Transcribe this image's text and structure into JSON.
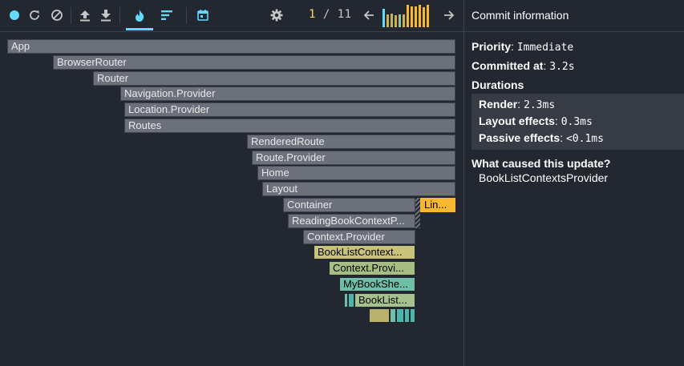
{
  "toolbar": {
    "icons": [
      "record-icon",
      "reload-icon",
      "clear-icon",
      "upload-icon",
      "download-icon",
      "flame-icon",
      "ranked-icon",
      "timeline-icon",
      "settings-icon",
      "arrow-left-icon",
      "arrow-right-icon"
    ],
    "accent": "#61dafb",
    "commit_current": "1",
    "commit_sep": "/",
    "commit_total": "11",
    "commit_bars": [
      {
        "level": 0.8,
        "color": "#61dafb"
      },
      {
        "level": 0.55,
        "color": "#d0b04e"
      },
      {
        "level": 0.6,
        "color": "#b8b86b"
      },
      {
        "level": 0.5,
        "color": "#d0b04e"
      },
      {
        "level": 0.55,
        "color": "#9cc09a"
      },
      {
        "level": 0.55,
        "color": "#d0b04e"
      },
      {
        "level": 0.95,
        "color": "#f7b731"
      },
      {
        "level": 0.9,
        "color": "#f7b731"
      },
      {
        "level": 0.9,
        "color": "#f7b731"
      },
      {
        "level": 0.95,
        "color": "#f7b731"
      },
      {
        "level": 0.85,
        "color": "#f7b731"
      },
      {
        "level": 0.95,
        "color": "#f7b731"
      }
    ]
  },
  "flame": {
    "nodes": [
      {
        "label": "App",
        "color": "gray"
      },
      {
        "label": "BrowserRouter",
        "color": "gray"
      },
      {
        "label": "Router",
        "color": "gray"
      },
      {
        "label": "Navigation.Provider",
        "color": "gray"
      },
      {
        "label": "Location.Provider",
        "color": "gray"
      },
      {
        "label": "Routes",
        "color": "gray"
      },
      {
        "label": "RenderedRoute",
        "color": "gray"
      },
      {
        "label": "Route.Provider",
        "color": "gray"
      },
      {
        "label": "Home",
        "color": "gray"
      },
      {
        "label": "Layout",
        "color": "gray"
      },
      {
        "label": "Container",
        "color": "gray"
      },
      {
        "label": "Lin...",
        "color": "#f7b731"
      },
      {
        "label": "ReadingBookContextP...",
        "color": "gray"
      },
      {
        "label": "Context.Provider",
        "color": "gray"
      },
      {
        "label": "BookListContext...",
        "color": "#c9c27a"
      },
      {
        "label": "Context.Provi...",
        "color": "#a7bc80"
      },
      {
        "label": "MyBookShe...",
        "color": "#6fbfa8"
      },
      {
        "label": "BookList...",
        "color": "#a4c18e"
      }
    ],
    "small_bars": [
      {
        "color": "#6fbfa8"
      },
      {
        "color": "#4db6ac"
      },
      {
        "color": "#b9b26c"
      },
      {
        "color": "#6fbfa8"
      },
      {
        "color": "#4db6ac"
      },
      {
        "color": "#4db6ac"
      },
      {
        "color": "#4db6ac"
      }
    ]
  },
  "panel": {
    "title": "Commit information",
    "priority_label": "Priority",
    "priority_value": "Immediate",
    "committed_label": "Committed at",
    "committed_value": "3.2s",
    "durations_label": "Durations",
    "render_label": "Render",
    "render_value": "2.3ms",
    "layout_label": "Layout effects",
    "layout_value": "0.3ms",
    "passive_label": "Passive effects",
    "passive_value": "<0.1ms",
    "cause_label": "What caused this update?",
    "cause_value": "BookListContextsProvider"
  }
}
